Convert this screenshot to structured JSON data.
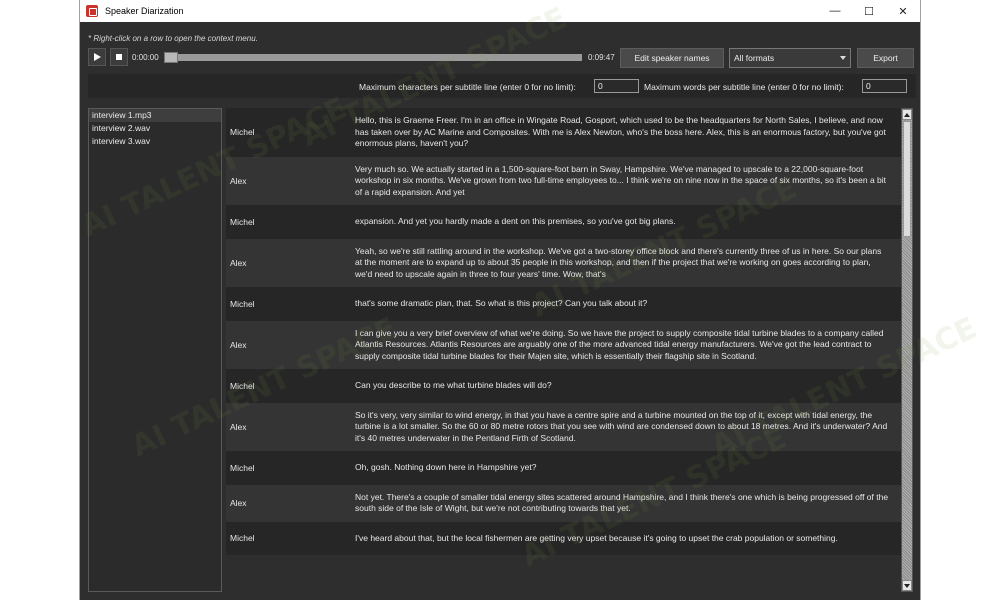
{
  "window": {
    "title": "Speaker Diarization",
    "controls": {
      "minimize": "—",
      "maximize": "☐",
      "close": "✕"
    }
  },
  "hint": "* Right-click on a row to open the context menu.",
  "player": {
    "play_icon": "play-icon",
    "stop_icon": "stop-icon",
    "current_time": "0:00:00",
    "total_time": "0:09:47",
    "progress": 0
  },
  "toolbar": {
    "edit_speakers_label": "Edit speaker names",
    "format_selected": "All formats",
    "export_label": "Export"
  },
  "limits": {
    "max_chars_label": "Maximum characters per subtitle line (enter 0 for no limit):",
    "max_chars_value": "0",
    "max_words_label": "Maximum words per subtitle line (enter 0 for no limit):",
    "max_words_value": "0"
  },
  "files": [
    {
      "name": "interview 1.mp3",
      "selected": true
    },
    {
      "name": "interview 2.wav",
      "selected": false
    },
    {
      "name": "interview 3.wav",
      "selected": false
    }
  ],
  "transcript": [
    {
      "speaker": "Michel",
      "text": "Hello, this is Graeme Freer. I'm in an office in Wingate Road, Gosport, which used to be the headquarters for North Sales, I believe, and now has taken over by AC Marine and Composites. With me is Alex Newton, who's the boss here. Alex, this is an enormous factory, but you've got enormous plans, haven't you?"
    },
    {
      "speaker": "Alex",
      "text": "Very much so. We actually started in a 1,500-square-foot barn in Sway, Hampshire. We've managed to upscale to a 22,000-square-foot workshop in six months. We've grown from two full-time employees to... I think we're on nine now in the space of six months, so it's been a bit of a rapid expansion. And yet"
    },
    {
      "speaker": "Michel",
      "text": "expansion. And yet you hardly made a dent on this premises, so you've got big plans."
    },
    {
      "speaker": "Alex",
      "text": "Yeah, so we're still rattling around in the workshop. We've got a two-storey office block and there's currently three of us in here. So our plans at the moment are to expand up to about 35 people in this workshop, and then if the project that we're working on goes according to plan, we'd need to upscale again in three to four years' time. Wow, that's"
    },
    {
      "speaker": "Michel",
      "text": "that's some dramatic plan, that. So what is this project? Can you talk about it?"
    },
    {
      "speaker": "Alex",
      "text": "I can give you a very brief overview of what we're doing. So we have the project to supply composite tidal turbine blades to a company called Atlantis Resources. Atlantis Resources are arguably one of the more advanced tidal energy manufacturers. We've got the lead contract to supply composite tidal turbine blades for their Majen site, which is essentially their flagship site in Scotland."
    },
    {
      "speaker": "Michel",
      "text": "Can you describe to me what turbine blades will do?"
    },
    {
      "speaker": "Alex",
      "text": "So it's very, very similar to wind energy, in that you have a centre spire and a turbine mounted on the top of it, except with tidal energy, the turbine is a lot smaller. So the 60 or 80 metre rotors that you see with wind are condensed down to about 18 metres. And it's underwater? And it's 40 metres underwater in the Pentland Firth of Scotland."
    },
    {
      "speaker": "Michel",
      "text": "Oh, gosh. Nothing down here in Hampshire yet?"
    },
    {
      "speaker": "Alex",
      "text": "Not yet. There's a couple of smaller tidal energy sites scattered around Hampshire, and I think there's one which is being progressed off of the south side of the Isle of Wight, but we're not contributing towards that yet."
    },
    {
      "speaker": "Michel",
      "text": "I've heard about that, but the local fishermen are getting very upset because it's going to upset the crab population or something."
    }
  ],
  "watermark_text": "AI TALENT SPACE"
}
